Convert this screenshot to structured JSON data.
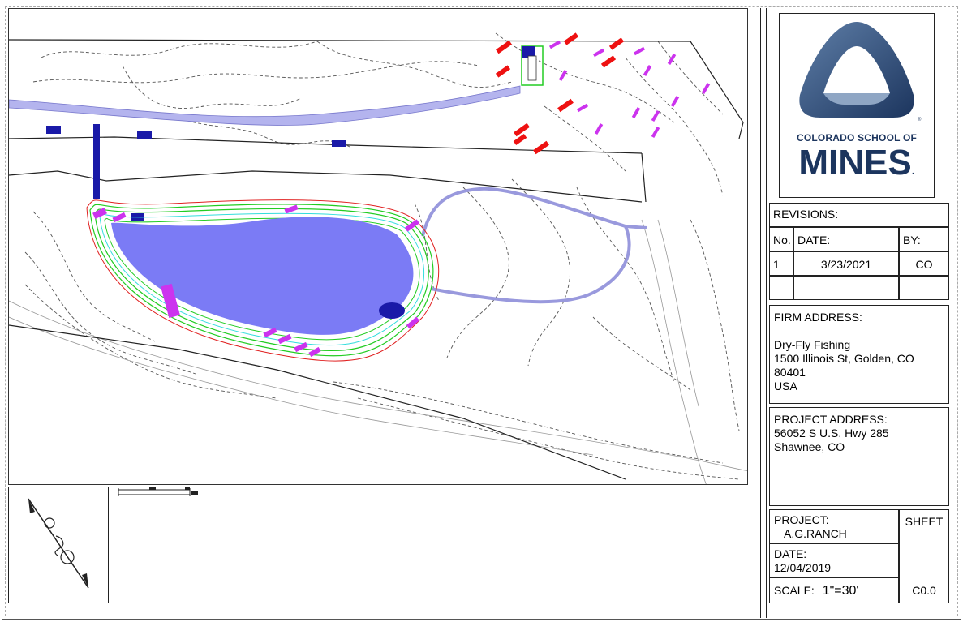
{
  "logo": {
    "line1": "COLORADO SCHOOL OF",
    "line2": "MINES",
    "line2_suffix": ".",
    "trademark": "®",
    "color_navy": "#1c355e",
    "color_slate": "#5f7fa8"
  },
  "revisions": {
    "header": "REVISIONS:",
    "col_no": "No.",
    "col_date": "DATE:",
    "col_by": "BY:",
    "rows": [
      {
        "no": "1",
        "date": "3/23/2021",
        "by": "CO"
      }
    ]
  },
  "firm": {
    "label": "FIRM ADDRESS:",
    "name": "Dry-Fly Fishing",
    "street": "1500 Illinois St, Golden, CO",
    "zip": "80401",
    "country": "USA"
  },
  "project_address": {
    "label": "PROJECT ADDRESS:",
    "street": "56052 S U.S. Hwy 285",
    "city": "Shawnee, CO"
  },
  "project": {
    "label": "PROJECT:",
    "name": "A.G.RANCH",
    "date_label": "DATE:",
    "date": "12/04/2019",
    "scale_label": "SCALE:",
    "scale": "1\"=30'"
  },
  "sheet": {
    "label": "SHEET",
    "number": "C0.0"
  },
  "colors": {
    "pond_fill": "#7b7bf5",
    "road_fill": "#b4b4ee",
    "culvert": "#1a1aa8",
    "contour_green": "#22cc22",
    "contour_red": "#e02020",
    "marker_magenta": "#cc33ee",
    "marker_red": "#ee1111"
  }
}
